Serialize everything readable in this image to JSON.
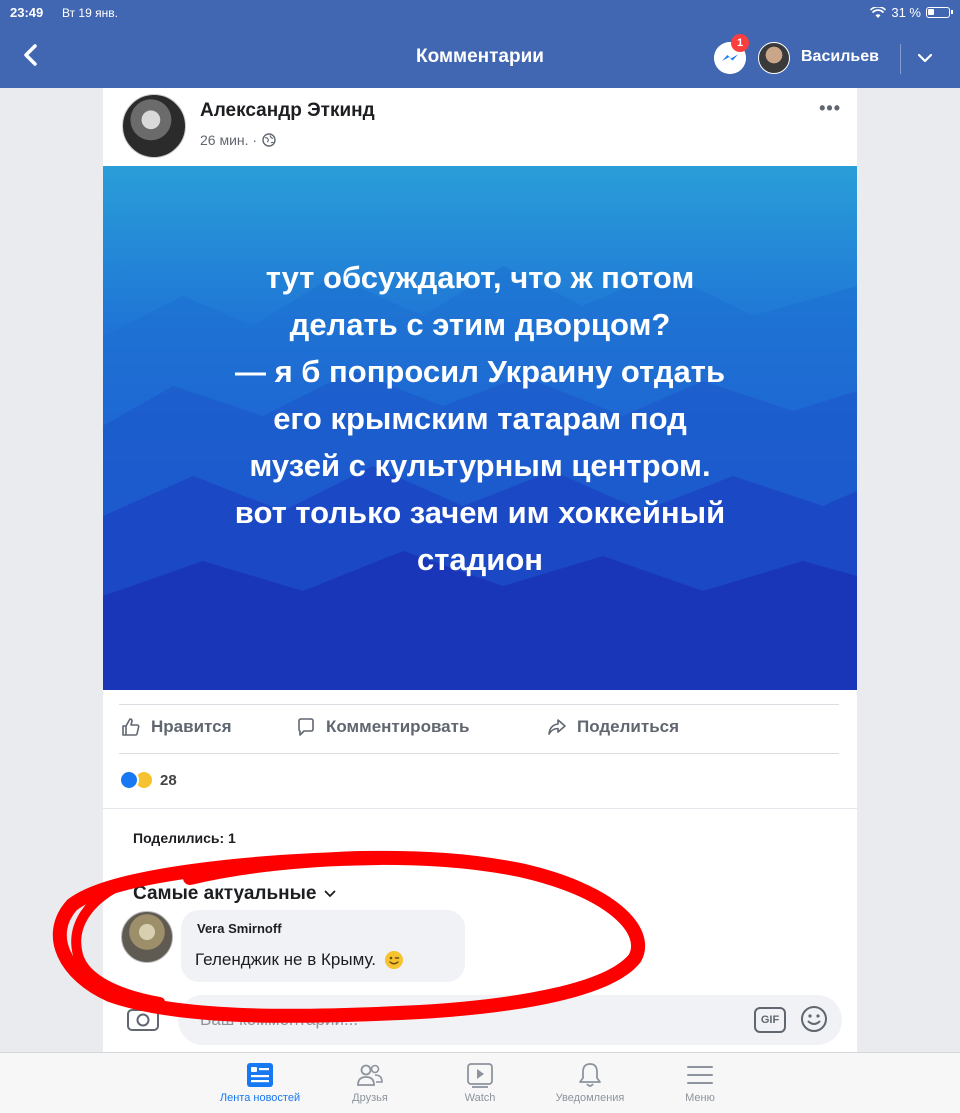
{
  "status": {
    "time": "23:49",
    "date": "Вт 19 янв.",
    "battery": "31 %"
  },
  "nav": {
    "title": "Комментарии",
    "messenger_badge": "1",
    "user_name": "Васильев"
  },
  "post": {
    "author": "Александр Эткинд",
    "time": "26 мин. ·",
    "image_text": "тут обсуждают, что ж потом\nделать с этим дворцом?\n— я б попросил Украину отдать\nего крымским татарам под\nмузей с культурным центром.\nвот только зачем им хоккейный\nстадион",
    "more": "•••"
  },
  "actions": {
    "like": "Нравится",
    "comment": "Комментировать",
    "share": "Поделиться"
  },
  "reactions": {
    "count": "28"
  },
  "shares_text": "Поделились: 1",
  "sort_label": "Самые актуальные",
  "comment": {
    "author": "Vera Smirnoff",
    "text": "Геленджик не в Крыму."
  },
  "composer": {
    "placeholder": "Ваш комментарий...",
    "gif": "GIF"
  },
  "tabs": [
    {
      "label": "Лента новостей",
      "icon": "news-feed-icon"
    },
    {
      "label": "Друзья",
      "icon": "friends-icon"
    },
    {
      "label": "Watch",
      "icon": "watch-icon"
    },
    {
      "label": "Уведомления",
      "icon": "bell-icon"
    },
    {
      "label": "Меню",
      "icon": "menu-icon"
    }
  ],
  "colors": {
    "brand": "#4267b2",
    "accent": "#1877f2",
    "scribble": "#ff0000"
  }
}
